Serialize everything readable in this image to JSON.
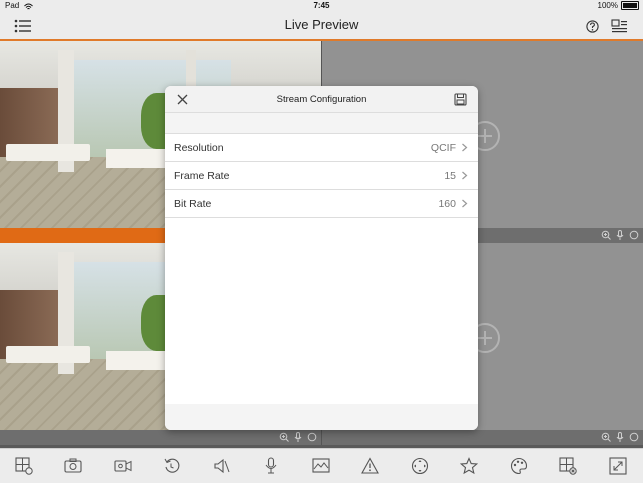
{
  "status_bar": {
    "device": "Pad",
    "time": "7:45",
    "battery": "100%"
  },
  "nav": {
    "title": "Live Preview",
    "left_icon": "list-menu-icon",
    "right_icons": [
      "help-icon",
      "layout-switch-icon"
    ]
  },
  "accent_color": "#e07a2a",
  "windows": [
    {
      "state": "live",
      "selected": true
    },
    {
      "state": "empty"
    },
    {
      "state": "live",
      "selected": false
    },
    {
      "state": "empty"
    }
  ],
  "modal": {
    "title": "Stream Configuration",
    "close_icon": "close-icon",
    "save_icon": "save-icon",
    "rows": [
      {
        "label": "Resolution",
        "value": "QCIF"
      },
      {
        "label": "Frame Rate",
        "value": "15"
      },
      {
        "label": "Bit Rate",
        "value": "160"
      }
    ]
  },
  "toolbar_icons": [
    "window-split-icon",
    "snapshot-icon",
    "record-icon",
    "playback-icon",
    "audio-icon",
    "talk-icon",
    "image-icon",
    "alarm-icon",
    "ptz-icon",
    "favorite-icon",
    "color-icon",
    "close-all-icon",
    "fullscreen-icon"
  ]
}
